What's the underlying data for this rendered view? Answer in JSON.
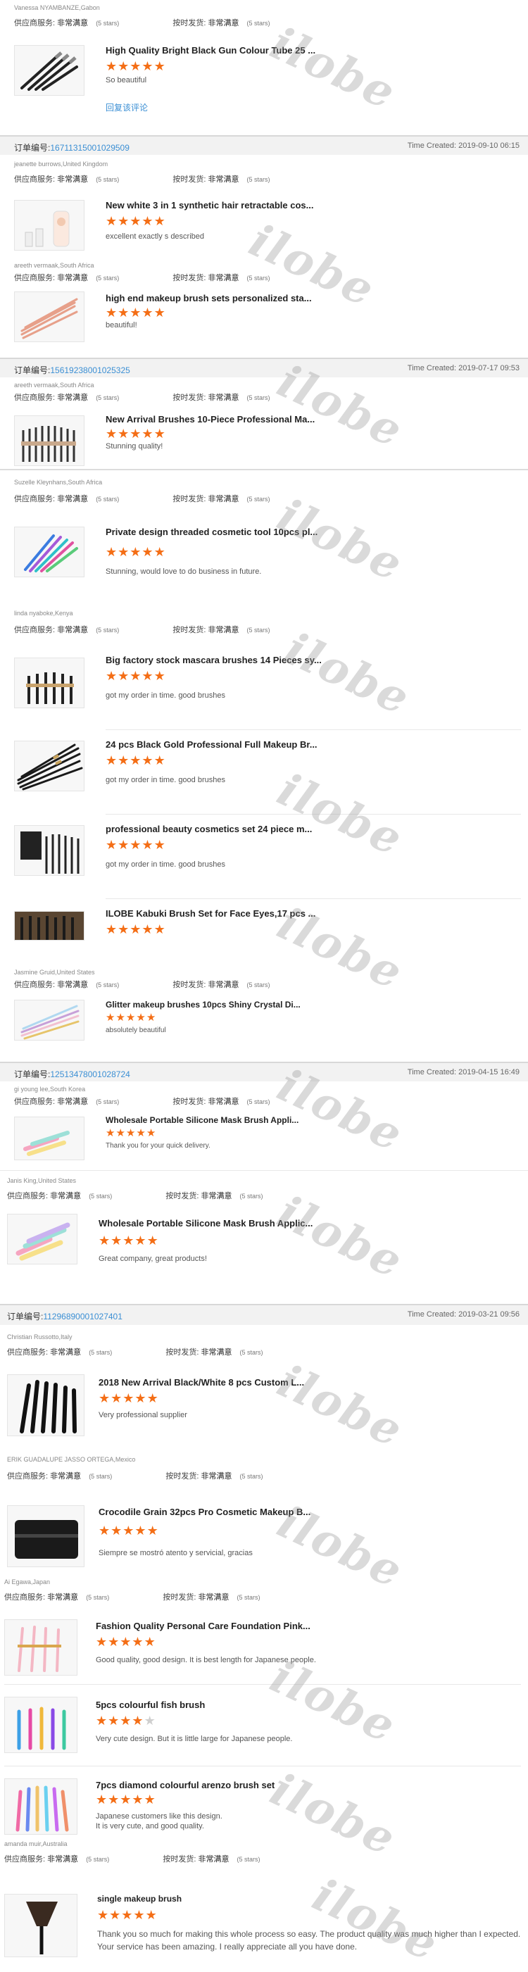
{
  "labels": {
    "supplier": "供应商服务:",
    "shipping": "按时发货:",
    "rating_value": "非常满意",
    "stars_note": "(5 stars)",
    "order_label": "订单编号:",
    "time_label": "Time Created:",
    "reply_link": "回复该评论"
  },
  "watermark": "ilobe",
  "colors": {
    "star": "#f46e16",
    "link": "#3b8fd4",
    "header_bg": "#f2f2f2"
  },
  "buyers": {
    "b1": "Vanessa NYAMBANZE,Gabon",
    "b2": "jeanette burrows,United Kingdom",
    "b3": "areeth vermaak,South Africa",
    "b4": "areeth vermaak,South Africa",
    "b5": "Suzelle Kleynhans,South Africa",
    "b6": "linda nyaboke,Kenya",
    "b7": "Jasmine Gruid,United States",
    "b8": "gi young lee,South Korea",
    "b9": "Janis King,United States",
    "b10": "Christian Russotto,Italy",
    "b11": "ERIK GUADALUPE JASSO ORTEGA,Mexico",
    "b12": "Ai Egawa,Japan",
    "b13": "amanda muir,Australia"
  },
  "orders": {
    "o1": {
      "number": "16711315001029509",
      "time": "2019-09-10 06:15"
    },
    "o2": {
      "number": "15619238001025325",
      "time": "2019-07-17 09:53"
    },
    "o3": {
      "number": "12513478001028724",
      "time": "2019-04-15 16:49"
    },
    "o4": {
      "number": "11296890001027401",
      "time": "2019-03-21 09:56"
    }
  },
  "reviews": {
    "r1": {
      "title": "High Quality Bright Black Gun Colour Tube 25 ...",
      "text": "So beautiful",
      "stars": 5
    },
    "r2": {
      "title": "New white 3 in 1 synthetic hair retractable cos...",
      "text": "excellent exactly s described",
      "stars": 5
    },
    "r3": {
      "title": "high end makeup brush sets personalized sta...",
      "text": "beautiful!",
      "stars": 5
    },
    "r4": {
      "title": "New Arrival Brushes 10-Piece Professional Ma...",
      "text": "Stunning quality!",
      "stars": 5
    },
    "r5": {
      "title": "Private design threaded cosmetic tool 10pcs pl...",
      "text": "Stunning, would love to do business in future.",
      "stars": 5
    },
    "r6": {
      "title": "Big factory stock mascara brushes 14 Pieces sy...",
      "text": "got my order in time.  good brushes",
      "stars": 5
    },
    "r7": {
      "title": "24 pcs Black Gold Professional Full Makeup Br...",
      "text": "got my order in time.  good brushes",
      "stars": 5
    },
    "r8": {
      "title": "professional beauty cosmetics set 24 piece m...",
      "text": "got my order in time.  good brushes",
      "stars": 5
    },
    "r9": {
      "title": "ILOBE Kabuki Brush Set for Face Eyes,17 pcs ...",
      "text": "",
      "stars": 5
    },
    "r10": {
      "title": "Glitter makeup brushes 10pcs Shiny Crystal Di...",
      "text": "absolutely beautiful",
      "stars": 5
    },
    "r11": {
      "title": "Wholesale Portable Silicone Mask Brush Appli...",
      "text": "Thank you for your quick delivery.",
      "stars": 5
    },
    "r12": {
      "title": "Wholesale Portable Silicone Mask Brush Applic...",
      "text": "Great company, great products!",
      "stars": 5
    },
    "r13": {
      "title": "2018 New Arrival Black/White 8 pcs Custom L...",
      "text": "Very professional supplier",
      "stars": 5
    },
    "r14": {
      "title": "Crocodile Grain 32pcs Pro Cosmetic Makeup B...",
      "text": "Siempre se mostró atento y servicial, gracias",
      "stars": 5
    },
    "r15": {
      "title": "Fashion Quality Personal Care Foundation Pink...",
      "text": "Good quality, good design. It is best length for Japanese people.",
      "stars": 5
    },
    "r16": {
      "title": "5pcs colourful fish brush",
      "text": "Very cute design. But it is little large for Japanese people.",
      "stars": 4
    },
    "r17": {
      "title": "7pcs diamond colourful arenzo brush set",
      "text": "Japanese customers like this design.",
      "text2": "It is very cute, and good quality.",
      "stars": 5
    },
    "r18": {
      "title": "single makeup brush",
      "text": "Thank you so much for making this whole process so easy. The product quality was much higher than I expected.",
      "text2": "Your service has been amazing. I really appreciate all you have done.",
      "stars": 5
    }
  }
}
